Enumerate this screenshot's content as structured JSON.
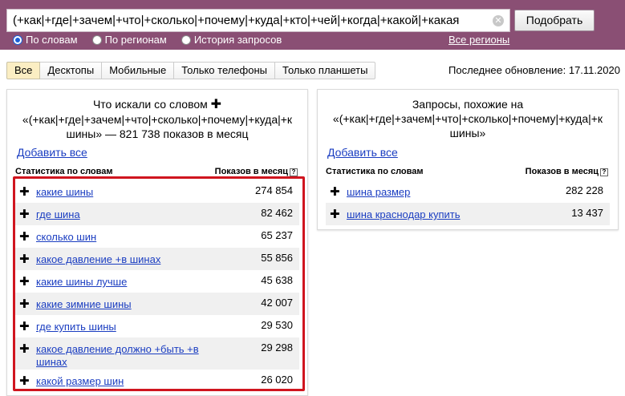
{
  "search": {
    "query": "(+как|+где|+зачем|+что|+сколько|+почему|+куда|+кто|+чей|+когда|+какой|+какая",
    "submit_label": "Подобрать",
    "radios": [
      {
        "label": "По словам",
        "checked": true
      },
      {
        "label": "По регионам",
        "checked": false
      },
      {
        "label": "История запросов",
        "checked": false
      }
    ],
    "regions_link": "Все регионы"
  },
  "tabs": [
    {
      "label": "Все",
      "active": true
    },
    {
      "label": "Десктопы",
      "active": false
    },
    {
      "label": "Мобильные",
      "active": false
    },
    {
      "label": "Только телефоны",
      "active": false
    },
    {
      "label": "Только планшеты",
      "active": false
    }
  ],
  "last_updated": "Последнее обновление: 17.11.2020",
  "left_panel": {
    "title_line1": "Что искали со словом",
    "title_line2": "«(+как|+где|+зачем|+что|+сколько|+почему|+куда|+к",
    "title_line3": "шины» — 821 738 показов в месяц",
    "add_all": "Добавить все",
    "col_phrase": "Статистика по словам",
    "col_count": "Показов в месяц",
    "rows": [
      {
        "phrase": "какие шины",
        "count": "274 854"
      },
      {
        "phrase": "где шина",
        "count": "82 462"
      },
      {
        "phrase": "сколько шин",
        "count": "65 237"
      },
      {
        "phrase": "какое давление +в шинах",
        "count": "55 856"
      },
      {
        "phrase": "какие шины лучше",
        "count": "45 638"
      },
      {
        "phrase": "какие зимние шины",
        "count": "42 007"
      },
      {
        "phrase": "где купить шины",
        "count": "29 530"
      },
      {
        "phrase": "какое давление должно +быть +в шинах",
        "count": "29 298"
      },
      {
        "phrase": "какой размер шин",
        "count": "26 020"
      }
    ]
  },
  "right_panel": {
    "title_line1": "Запросы, похожие на",
    "title_line2": "«(+как|+где|+зачем|+что|+сколько|+почему|+куда|+к",
    "title_line3": "шины»",
    "add_all": "Добавить все",
    "col_phrase": "Статистика по словам",
    "col_count": "Показов в месяц",
    "rows": [
      {
        "phrase": "шина размер",
        "count": "282 228"
      },
      {
        "phrase": "шина краснодар купить",
        "count": "13 437"
      }
    ]
  },
  "colors": {
    "topbar": "#8a4f74",
    "link": "#1a3dc1",
    "highlight": "#d0151f",
    "active_tab": "#fbeec3"
  }
}
